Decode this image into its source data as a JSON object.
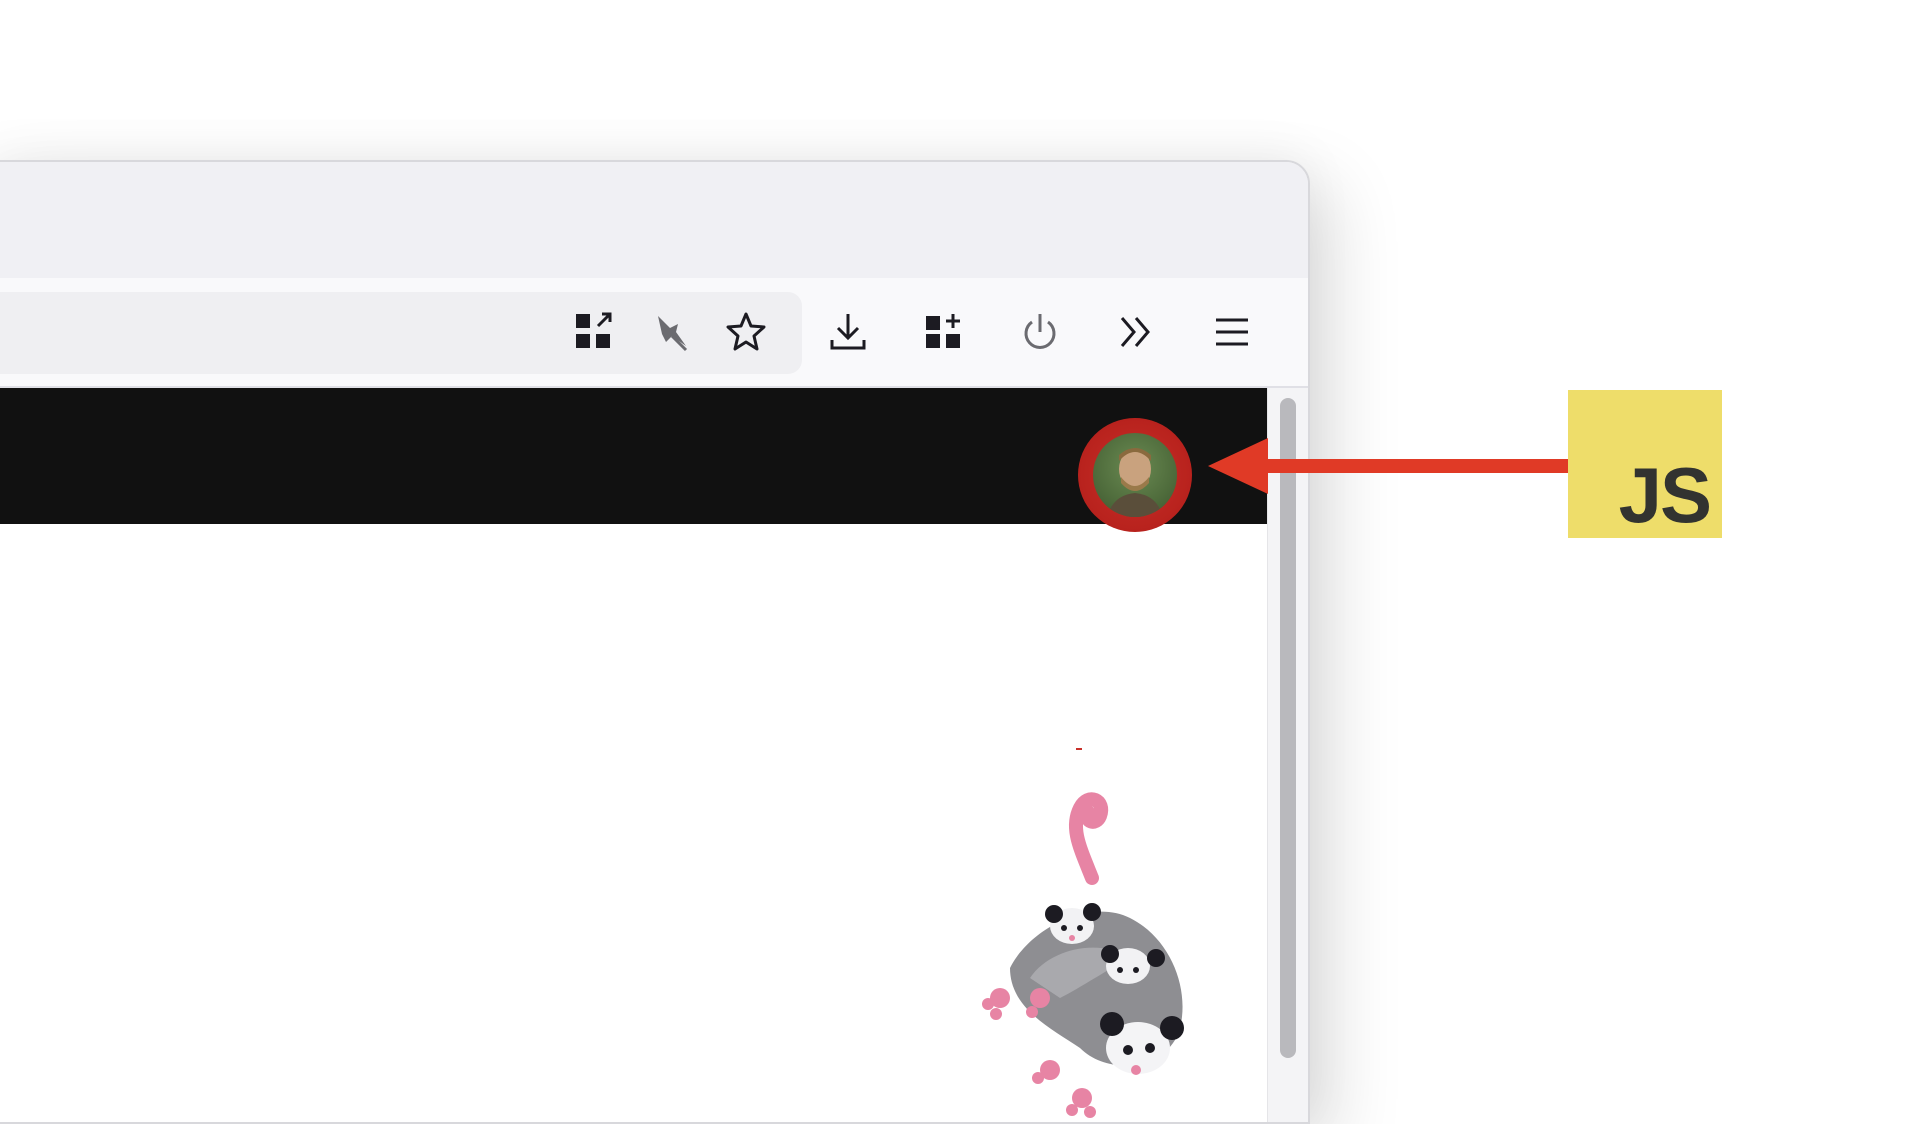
{
  "toolbar": {
    "buttons": [
      {
        "name": "page-actions",
        "icon": "qr-code-icon"
      },
      {
        "name": "pin",
        "icon": "pin-icon"
      },
      {
        "name": "bookmark",
        "icon": "star-icon"
      },
      {
        "name": "downloads",
        "icon": "download-icon"
      },
      {
        "name": "extensions",
        "icon": "extensions-icon"
      },
      {
        "name": "power",
        "icon": "power-icon"
      },
      {
        "name": "overflow",
        "icon": "chevron-double-right-icon"
      },
      {
        "name": "menu",
        "icon": "hamburger-menu-icon"
      }
    ]
  },
  "page": {
    "header_color": "#111111",
    "avatar_ring_color": "#c8302a"
  },
  "annotation": {
    "arrow_color": "#e03a26",
    "logo_text": "JS",
    "logo_color": "#eedd6a"
  }
}
